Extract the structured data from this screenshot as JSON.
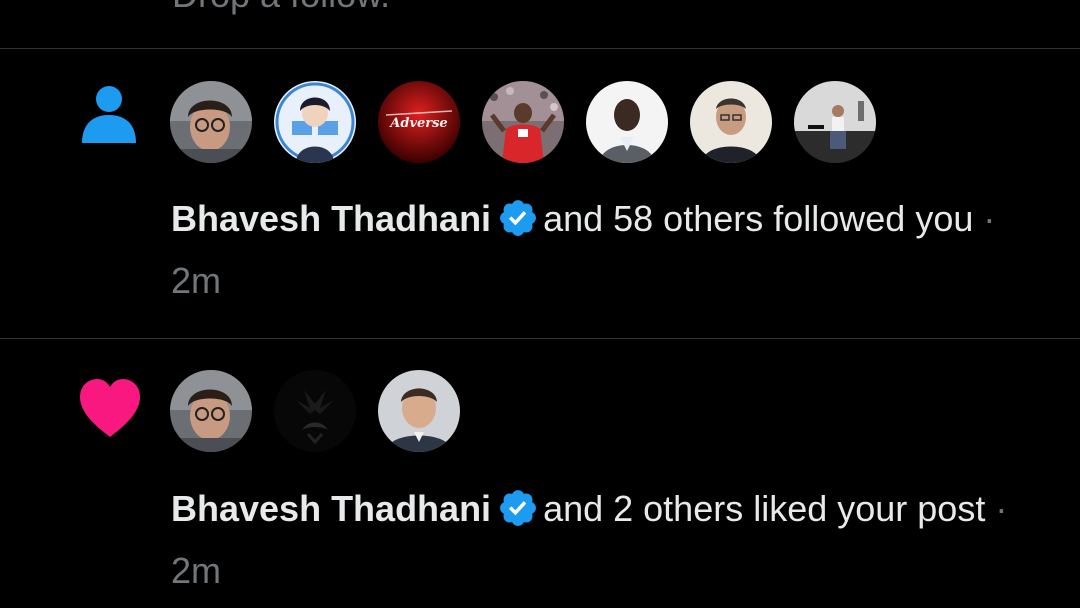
{
  "previous_item": {
    "partial_text": "Drop a follow."
  },
  "notifications": [
    {
      "type": "follow",
      "type_icon": "person-icon",
      "icon_color": "#1d9bf0",
      "avatars": [
        "avatar-1",
        "avatar-2",
        "avatar-3",
        "avatar-4",
        "avatar-5",
        "avatar-6",
        "avatar-7"
      ],
      "name": "Bhavesh Thadhani",
      "verified": true,
      "action": "and 58 others followed you",
      "separator": "·",
      "time": "2m"
    },
    {
      "type": "like",
      "type_icon": "heart-icon",
      "icon_color": "#f91880",
      "avatars": [
        "avatar-1",
        "avatar-2",
        "avatar-3"
      ],
      "name": "Bhavesh Thadhani",
      "verified": true,
      "action": "and 2 others liked your post",
      "separator": "·",
      "time": "2m"
    }
  ],
  "colors": {
    "background": "#000000",
    "text_primary": "#e7e9ea",
    "text_secondary": "#71767b",
    "divider": "#2f3336",
    "verified_blue": "#1d9bf0"
  }
}
